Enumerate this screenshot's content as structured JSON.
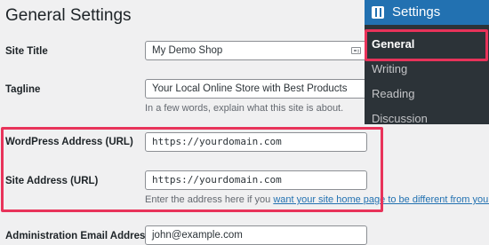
{
  "page": {
    "title": "General Settings"
  },
  "fields": {
    "site_title": {
      "label": "Site Title",
      "value": "My Demo Shop"
    },
    "tagline": {
      "label": "Tagline",
      "value": "Your Local Online Store with Best Products",
      "help": "In a few words, explain what this site is about."
    },
    "wp_address": {
      "label": "WordPress Address (URL)",
      "value": "https://yourdomain.com"
    },
    "site_address": {
      "label": "Site Address (URL)",
      "value": "https://yourdomain.com",
      "help_prefix": "Enter the address here if you ",
      "help_link": "want your site home page to be different from your Wo"
    },
    "admin_email": {
      "label": "Administration Email Address",
      "value": "john@example.com"
    }
  },
  "admin_menu": {
    "heading": "Settings",
    "items": [
      "General",
      "Writing",
      "Reading",
      "Discussion"
    ],
    "current": "General"
  },
  "colors": {
    "highlight": "#e8335a",
    "menu_accent": "#2271b1",
    "menu_bg": "#1d2327",
    "link": "#2271b1"
  }
}
